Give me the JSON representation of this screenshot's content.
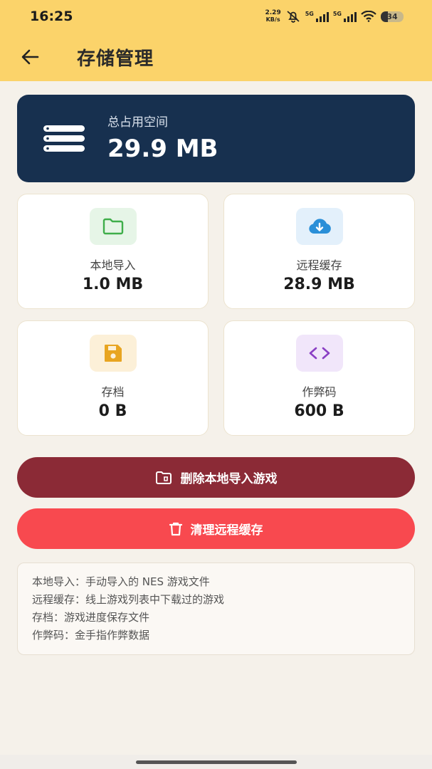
{
  "status_bar": {
    "time": "16:25",
    "net_speed_value": "2.29",
    "net_speed_unit": "KB/s",
    "sim1_label": "5G",
    "sim2_label": "5G",
    "battery": "34"
  },
  "header": {
    "title": "存储管理",
    "background": "#fbd36a"
  },
  "total": {
    "label": "总占用空间",
    "value": "29.9 MB",
    "background": "#17304f"
  },
  "stats": [
    {
      "label": "本地导入",
      "value": "1.0 MB",
      "icon": "folder-icon",
      "color": "#3fae4a",
      "tint": "#e6f5e7"
    },
    {
      "label": "远程缓存",
      "value": "28.9 MB",
      "icon": "cloud-download-icon",
      "color": "#2a8fd8",
      "tint": "#e3f0fb"
    },
    {
      "label": "存档",
      "value": "0 B",
      "icon": "save-icon",
      "color": "#e8a521",
      "tint": "#fcf0d8"
    },
    {
      "label": "作弊码",
      "value": "600 B",
      "icon": "code-icon",
      "color": "#8a3fc4",
      "tint": "#f1e6fa"
    }
  ],
  "actions": {
    "delete_local": "删除本地导入游戏",
    "clear_remote": "清理远程缓存"
  },
  "info": [
    "本地导入：手动导入的 NES 游戏文件",
    "远程缓存：线上游戏列表中下载过的游戏",
    "存档：游戏进度保存文件",
    "作弊码：金手指作弊数据"
  ]
}
